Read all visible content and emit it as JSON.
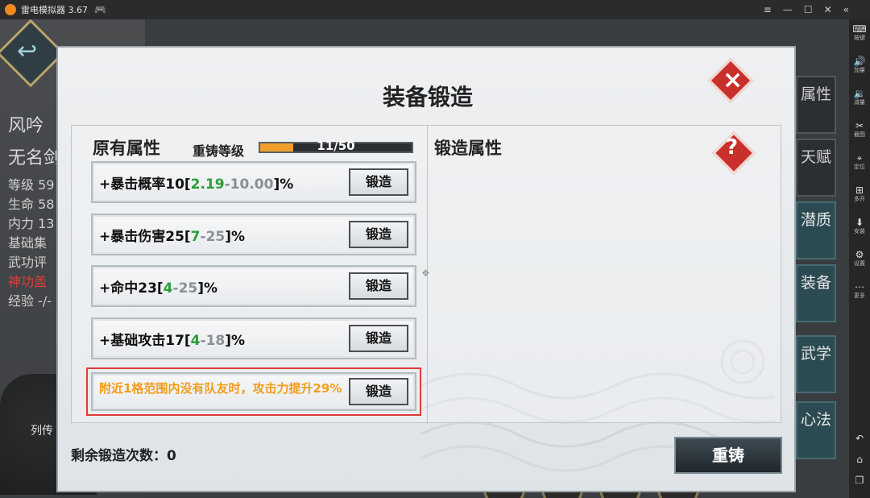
{
  "emulator": {
    "title": "雷电模拟器 3.67",
    "sidebar": [
      {
        "label": "按键",
        "icon": "keyboard-icon"
      },
      {
        "label": "加量",
        "icon": "volume-up-icon"
      },
      {
        "label": "减量",
        "icon": "volume-down-icon"
      },
      {
        "label": "截图",
        "icon": "scissors-icon"
      },
      {
        "label": "定位",
        "icon": "location-pin-icon"
      },
      {
        "label": "多开",
        "icon": "multi-instance-icon"
      },
      {
        "label": "安装",
        "icon": "apk-install-icon"
      },
      {
        "label": "设置",
        "icon": "gear-icon"
      },
      {
        "label": "更多",
        "icon": "more-dots-icon"
      }
    ]
  },
  "background": {
    "name_title": "风吟",
    "name_sub": "无名剑",
    "stats": [
      "等级 59",
      "生命 58",
      "内力 13",
      "基础集",
      "武功评"
    ],
    "special_line": "神功盖",
    "exp_line": "经验 -/-",
    "liezhuan": "列传",
    "right_tabs": [
      {
        "label": "属性"
      },
      {
        "label": "天赋"
      },
      {
        "label": "潜质"
      },
      {
        "label": "装备"
      },
      {
        "label": "武学"
      },
      {
        "label": "心法"
      }
    ]
  },
  "dialog": {
    "title": "装备锻造",
    "original_title": "原有属性",
    "recast_level_label": "重铸等级",
    "recast_progress_text": "11/50",
    "recast_progress": 0.22,
    "forge_title": "锻造属性",
    "rows": [
      {
        "prefix": "+暴击概率10[",
        "min": "2.19",
        "sep": "-10.00",
        "suffix": "]%",
        "button": "锻造"
      },
      {
        "prefix": "+暴击伤害25[",
        "min": "7",
        "sep": "-25",
        "suffix": "]%",
        "button": "锻造"
      },
      {
        "prefix": "+命中23[",
        "min": "4",
        "sep": "-25",
        "suffix": "]%",
        "button": "锻造"
      },
      {
        "prefix": "+基础攻击17[",
        "min": "4",
        "sep": "-18",
        "suffix": "]%",
        "button": "锻造"
      }
    ],
    "special_row": {
      "text": "附近1格范围内没有队友时，攻击力提升29%",
      "button": "锻造"
    },
    "remaining_label": "剩余锻造次数：0",
    "recast_button": "重铸",
    "close_symbol": "×",
    "help_symbol": "?"
  }
}
